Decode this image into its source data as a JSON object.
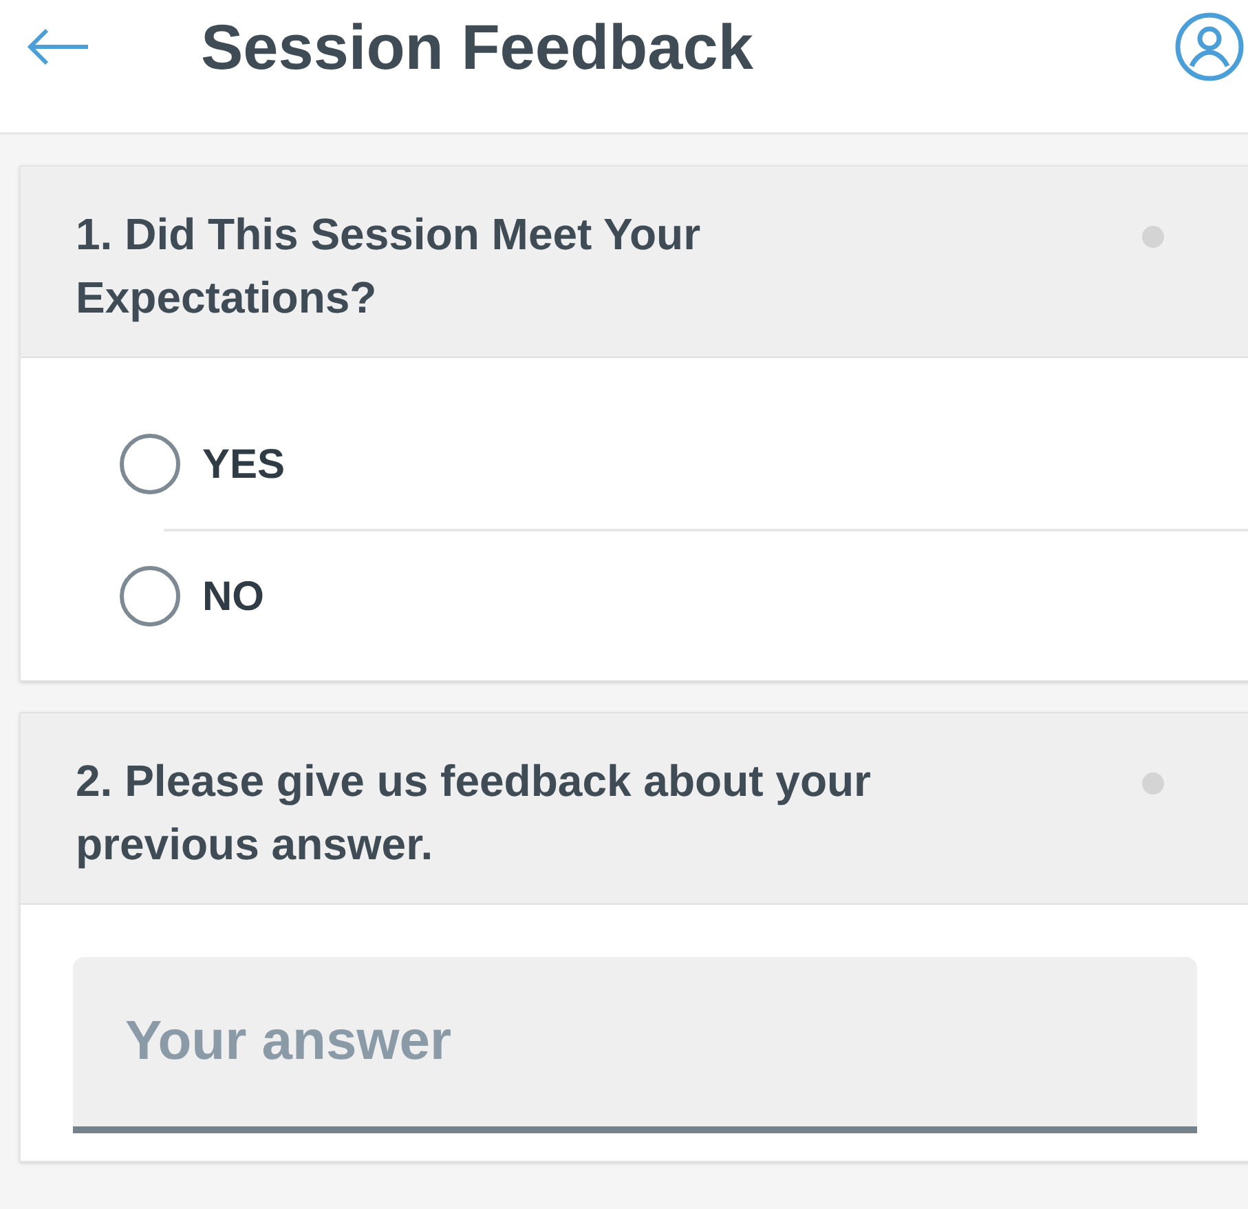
{
  "header": {
    "title": "Session Feedback"
  },
  "questions": [
    {
      "kind": "radio",
      "title": "1. Did This Session Meet Your Expectations?",
      "options": [
        {
          "label": "YES",
          "selected": false
        },
        {
          "label": "NO",
          "selected": false
        }
      ]
    },
    {
      "kind": "text",
      "title": "2. Please give us feedback about your previous answer.",
      "placeholder": "Your answer"
    }
  ]
}
